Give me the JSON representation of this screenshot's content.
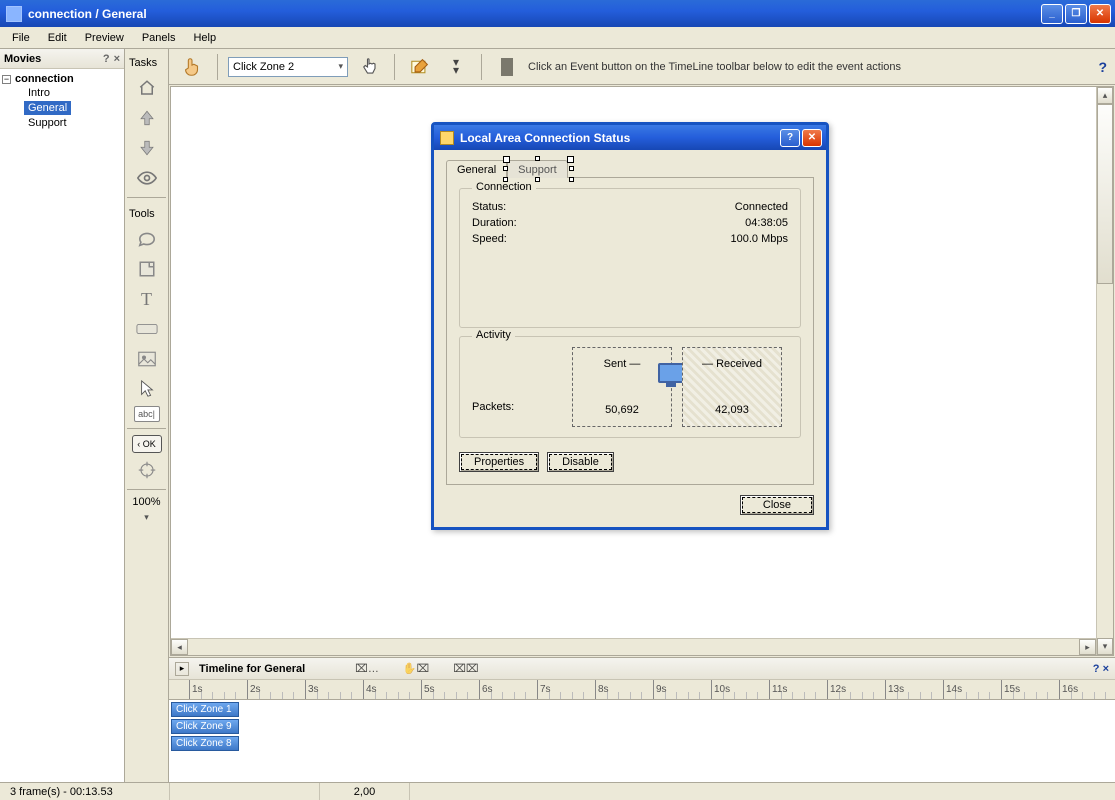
{
  "window": {
    "title": "connection / General"
  },
  "menu": [
    "File",
    "Edit",
    "Preview",
    "Panels",
    "Help"
  ],
  "movies": {
    "header": "Movies",
    "root": "connection",
    "items": [
      "Intro",
      "General",
      "Support"
    ],
    "selected_index": 1
  },
  "toolcol": {
    "section_tasks": "Tasks",
    "section_tools": "Tools",
    "zoom": "100%"
  },
  "stageToolbar": {
    "combo": "Click Zone 2",
    "hint": "Click an Event button on the TimeLine toolbar below to edit the event actions",
    "help": "?"
  },
  "dialog": {
    "title": "Local Area Connection Status",
    "tabs": [
      "General",
      "Support"
    ],
    "connection": {
      "legend": "Connection",
      "status_label": "Status:",
      "status_value": "Connected",
      "duration_label": "Duration:",
      "duration_value": "04:38:05",
      "speed_label": "Speed:",
      "speed_value": "100.0 Mbps"
    },
    "activity": {
      "legend": "Activity",
      "sent_label": "Sent",
      "received_label": "Received",
      "packets_label": "Packets:",
      "sent_value": "50,692",
      "received_value": "42,093"
    },
    "buttons": {
      "properties": "Properties",
      "disable": "Disable",
      "close": "Close"
    }
  },
  "timeline": {
    "title": "Timeline for General",
    "zones": [
      "Click Zone 1",
      "Click Zone 9",
      "Click Zone 8"
    ],
    "ticks": [
      "1s",
      "2s",
      "3s",
      "4s",
      "5s",
      "6s",
      "7s",
      "8s",
      "9s",
      "10s",
      "11s",
      "12s",
      "13s",
      "14s",
      "15s",
      "16s"
    ]
  },
  "status": {
    "frames": "3 frame(s) - 00:13.53",
    "pos": "2,00"
  }
}
